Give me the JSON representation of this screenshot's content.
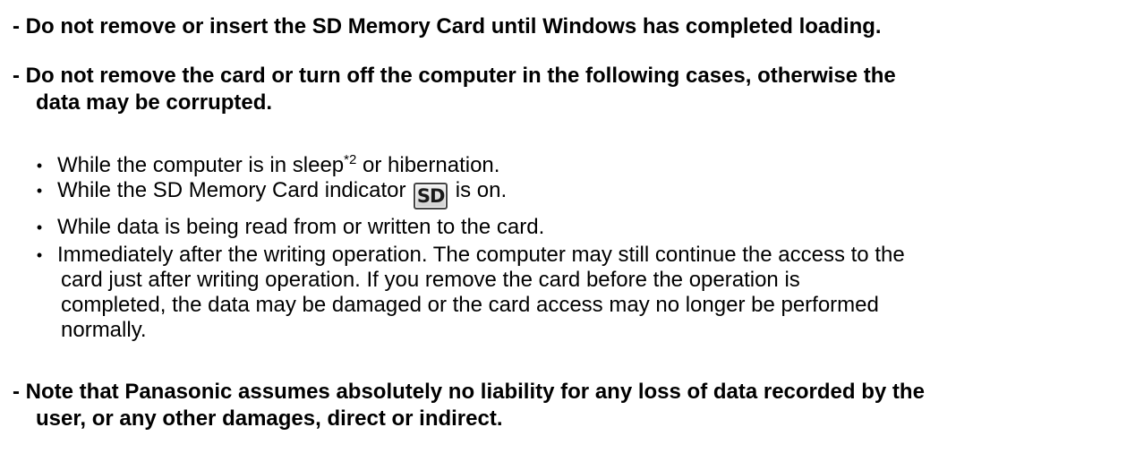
{
  "notices": {
    "n1": {
      "text": "- Do not remove or insert the SD Memory Card until Windows has completed loading."
    },
    "n2": {
      "line1": "- Do not remove the card or turn off the computer in the following cases, otherwise the",
      "line2": "data may be corrupted."
    },
    "n3": {
      "line1": "- Note that Panasonic assumes absolutely no liability for any loss of data recorded by the",
      "line2": "user, or any other damages, direct or indirect."
    }
  },
  "bullet_char": "•",
  "cases": {
    "sleep": {
      "before": "While the computer is in sleep",
      "footnote": "*2",
      "after": " or hibernation."
    },
    "indicator": {
      "before": "While the SD Memory Card indicator ",
      "icon_label": "SD",
      "icon_name": "sd-indicator-icon",
      "after": " is on."
    },
    "reading": {
      "text": "While data is being read from or written to the card."
    },
    "writing": {
      "line1": "Immediately after the writing operation. The computer may still continue the access to the",
      "line2": "card just after writing operation. If you remove the card before the operation is",
      "line3": "completed, the data may be damaged or the card access may no longer be performed",
      "line4": "normally."
    }
  }
}
